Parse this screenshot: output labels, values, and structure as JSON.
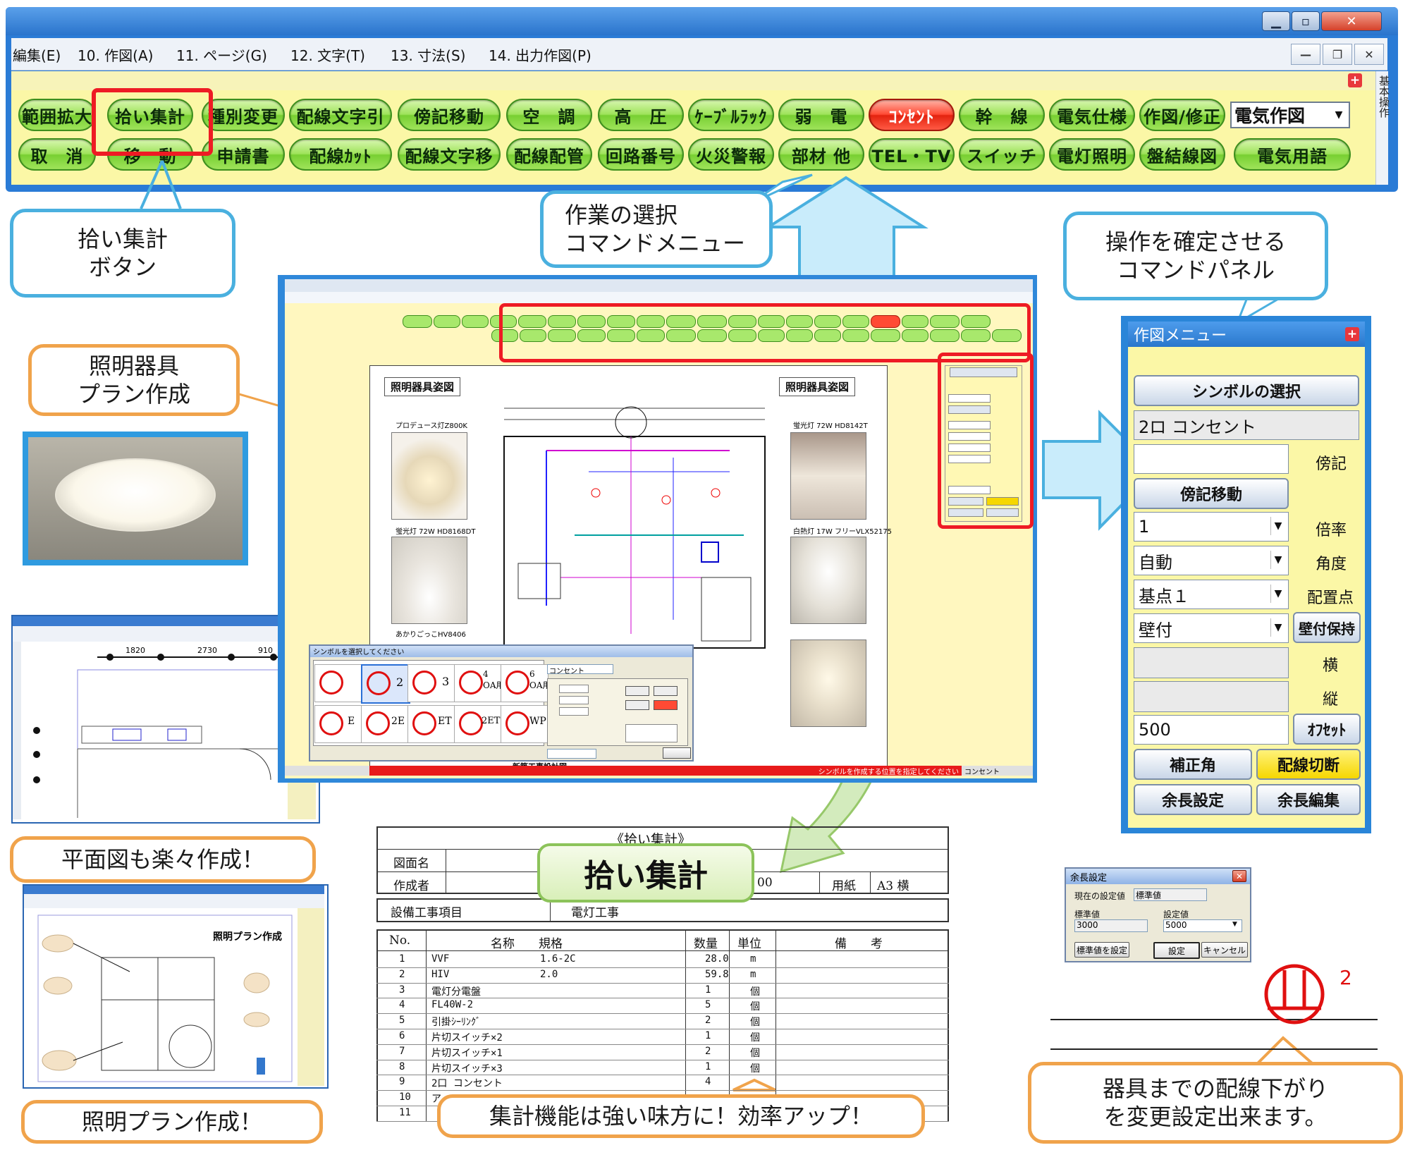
{
  "window": {
    "menu": [
      "編集(E)",
      "10. 作図(A)",
      "11. ページ(G)",
      "12. 文字(T)",
      "13. 寸法(S)",
      "14. 出力作図(P)"
    ],
    "side_tab": "基本操作",
    "combo_value": "電気作図",
    "buttons_row1": [
      "範囲拡大",
      "拾い集計",
      "種別変更",
      "配線文字引",
      "傍記移動",
      "空　調",
      "高　圧",
      "ｹｰﾌﾞﾙﾗｯｸ",
      "弱　電",
      "ｺﾝｾﾝﾄ",
      "幹　線",
      "電気仕様",
      "作図/修正"
    ],
    "buttons_row2": [
      "取　消",
      "移　動",
      "申請書",
      "配線ｶｯﾄ",
      "配線文字移",
      "配線配管",
      "回路番号",
      "火災警報",
      "部材 他",
      "TEL・TV",
      "スイッチ",
      "電灯照明",
      "盤結線図",
      "電気用語"
    ]
  },
  "callouts": {
    "pickup_button": [
      "拾い集計",
      "ボタン"
    ],
    "command_menu": [
      "作業の選択",
      "コマンドメニュー"
    ],
    "command_panel": [
      "操作を確定させる",
      "コマンドパネル"
    ],
    "lighting_plan": [
      "照明器具",
      "プラン作成"
    ],
    "floor_plan": "平面図も楽々作成！",
    "lighting_plan2": "照明プラン作成！",
    "aggregation": "集計機能は強い味方に！効率アップ！",
    "wiring": [
      "器具までの配線下がり",
      "を変更設定出来ます。"
    ],
    "pickup_label": "拾い集計"
  },
  "cad": {
    "sheet_title_left": "照明器具姿図",
    "sheet_title_right": "照明器具姿図",
    "fixtures_left": [
      "プロデュース灯Z800K",
      "蛍光灯 72W HD8168DT",
      "あかりごっこHV8406"
    ],
    "fixtures_right": [
      "蛍光灯 72W HD8142T",
      "白熱灯 17W フリーVLX52175"
    ],
    "footer_title": "新築工事設計図",
    "status": "シンボルを作成する位置を指定してください",
    "status_right": "コンセント",
    "dialog_title": "シンボルを選択してください",
    "dialog_combo": "コンセント",
    "symbol_labels": [
      "",
      "2",
      "3",
      "4\nOA用",
      "6\nOA用",
      "",
      "E",
      "2E",
      "ET",
      "2ET",
      "WP"
    ]
  },
  "panel": {
    "title": "作図メニュー",
    "select_symbol": "シンボルの選択",
    "selected": "2ロ コンセント",
    "note_label": "傍記",
    "note_move": "傍記移動",
    "scale_value": "1",
    "scale_label": "倍率",
    "angle_value": "自動",
    "angle_label": "角度",
    "base_value": "基点１",
    "base_label": "配置点",
    "mount_value": "壁付",
    "mount_hold": "壁付保持",
    "horiz_label": "横",
    "vert_label": "縦",
    "offset_value": "500",
    "offset_btn": "ｵﾌｾｯﾄ",
    "correct_angle": "補正角",
    "cut_wiring": "配線切断",
    "margin_setting": "余長設定",
    "margin_edit": "余長編集"
  },
  "agg_table": {
    "title": "《拾い集計》",
    "drawing_name_label": "図面名",
    "creator_label": "作成者",
    "scale_text": "00",
    "paper_label": "用紙",
    "paper_value": "A3 横",
    "item_label": "設備工事項目",
    "item_value": "電灯工事",
    "headers": [
      "No.",
      "名称　　規格",
      "数量",
      "単位",
      "備　　考"
    ],
    "rows": [
      {
        "no": "1",
        "name": "VVF",
        "spec": "1.6-2C",
        "qty": "28.0",
        "unit": "m"
      },
      {
        "no": "2",
        "name": "HIV",
        "spec": "2.0",
        "qty": "59.8",
        "unit": "m"
      },
      {
        "no": "3",
        "name": "電灯分電盤",
        "spec": "",
        "qty": "1",
        "unit": "個"
      },
      {
        "no": "4",
        "name": "FL40W-2",
        "spec": "",
        "qty": "5",
        "unit": "個"
      },
      {
        "no": "5",
        "name": "引掛ｼｰﾘﾝｸﾞ",
        "spec": "",
        "qty": "2",
        "unit": "個"
      },
      {
        "no": "6",
        "name": "片切スイッチ×2",
        "spec": "",
        "qty": "1",
        "unit": "個"
      },
      {
        "no": "7",
        "name": "片切スイッチ×1",
        "spec": "",
        "qty": "2",
        "unit": "個"
      },
      {
        "no": "8",
        "name": "片切スイッチ×3",
        "spec": "",
        "qty": "1",
        "unit": "個"
      },
      {
        "no": "9",
        "name": "2口 コンセント",
        "spec": "",
        "qty": "4",
        "unit": ""
      },
      {
        "no": "10",
        "name": "ア",
        "spec": "",
        "qty": "",
        "unit": ""
      },
      {
        "no": "11",
        "name": "",
        "spec": "",
        "qty": "",
        "unit": ""
      }
    ]
  },
  "margin_dialog": {
    "title": "余長設定",
    "current_label": "現在の設定値",
    "current_value": "標準値",
    "std_label": "標準値",
    "set_label": "設定値",
    "std_value": "3000",
    "set_value": "5000",
    "btn_std": "標準値を設定",
    "btn_ok": "設定",
    "btn_cancel": "キャンセル"
  },
  "symbol_number": "2",
  "floorplan_dims": [
    "1820",
    "2730",
    "910"
  ],
  "lighting_plan_title": "照明プラン作成"
}
